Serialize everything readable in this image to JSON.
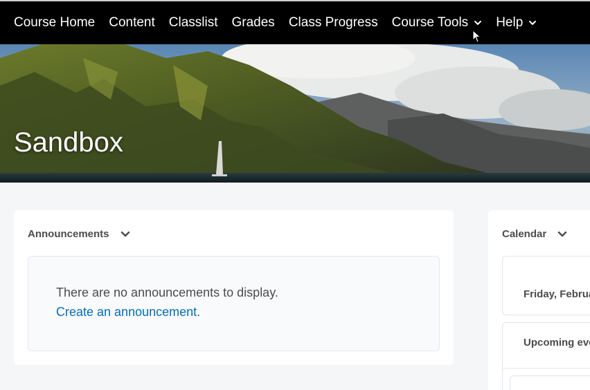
{
  "nav": {
    "items": [
      {
        "label": "Course Home",
        "has_menu": false
      },
      {
        "label": "Content",
        "has_menu": false
      },
      {
        "label": "Classlist",
        "has_menu": false
      },
      {
        "label": "Grades",
        "has_menu": false
      },
      {
        "label": "Class Progress",
        "has_menu": false
      },
      {
        "label": "Course Tools",
        "has_menu": true
      },
      {
        "label": "Help",
        "has_menu": true
      }
    ],
    "menu_icon": "chevron-down-icon",
    "background": "#000000"
  },
  "banner": {
    "title": "Sandbox"
  },
  "announcements": {
    "title": "Announcements",
    "empty_message": "There are no announcements to display.",
    "create_link": "Create an announcement",
    "create_suffix": "."
  },
  "calendar": {
    "title": "Calendar",
    "date_label": "Friday, Februa",
    "upcoming_label": "Upcoming eve"
  },
  "colors": {
    "link": "#006fbf",
    "page_bg": "#f5f6f8",
    "text": "#494c4e"
  }
}
